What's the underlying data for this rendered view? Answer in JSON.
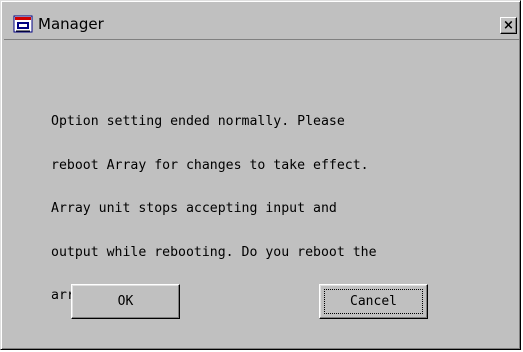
{
  "window": {
    "title": "Manager",
    "close_label": "×",
    "app_icon": "manager-app-icon"
  },
  "message": {
    "lines": [
      "Option setting ended normally. Please",
      "reboot Array for changes to take effect.",
      "Array unit stops accepting input and",
      "output while rebooting. Do you reboot the",
      "array unit now ?"
    ]
  },
  "buttons": {
    "ok_label": "OK",
    "cancel_label": "Cancel",
    "focused": "cancel"
  }
}
